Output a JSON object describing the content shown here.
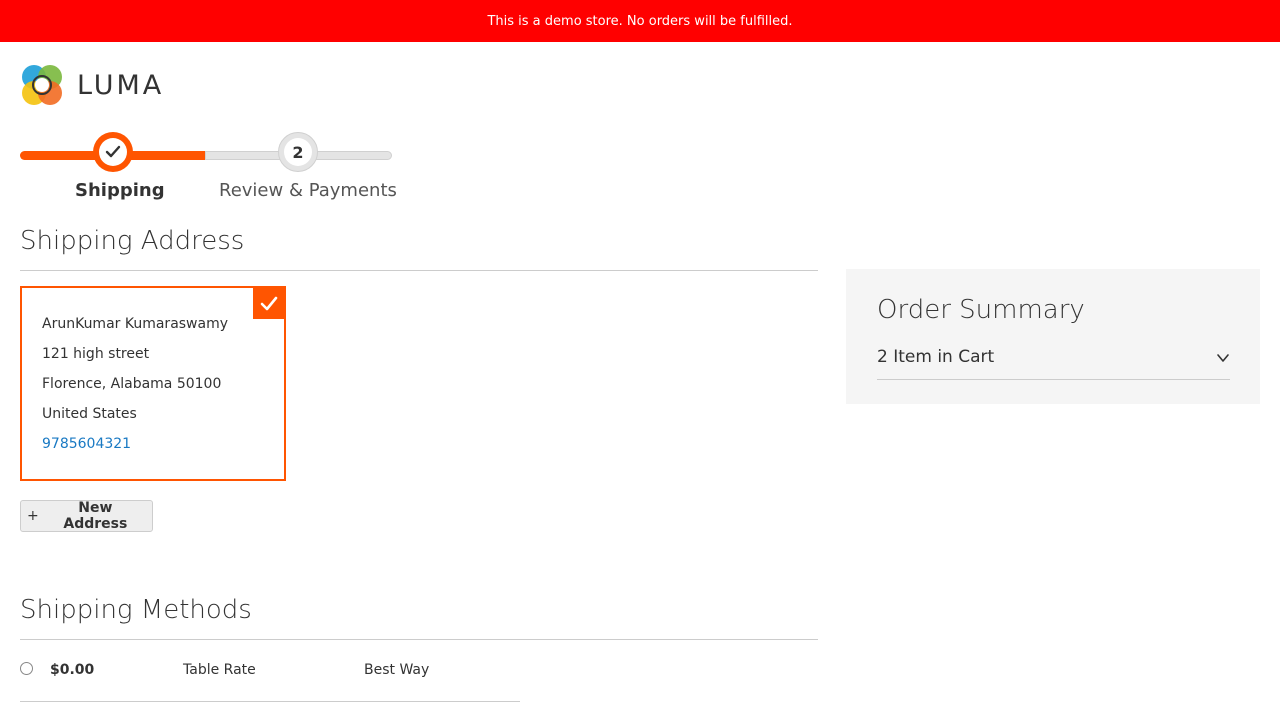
{
  "banner": {
    "text": "This is a demo store. No orders will be fulfilled."
  },
  "brand": {
    "logo_text": "LUMA",
    "accent": "#ff5501",
    "link_color": "#1979c3",
    "banner_color": "#ff0000"
  },
  "progress": {
    "steps": [
      {
        "label": "Shipping",
        "state": "complete",
        "icon": "checkmark-icon"
      },
      {
        "label": "Review & Payments",
        "state": "pending",
        "number": "2"
      }
    ]
  },
  "shipping_address": {
    "title": "Shipping Address",
    "selected_address": {
      "name": "ArunKumar Kumaraswamy",
      "street": "121 high street",
      "city_line": "Florence, Alabama 50100",
      "country": "United States",
      "phone": "9785604321"
    },
    "new_address_label": "New Address",
    "new_address_icon": "+"
  },
  "shipping_methods": {
    "title": "Shipping Methods",
    "rows": [
      {
        "price": "$0.00",
        "carrier": "Table Rate",
        "method": "Best Way",
        "selected": false
      }
    ]
  },
  "order_summary": {
    "title": "Order Summary",
    "cart_label": "2 Item in Cart",
    "toggle_icon": "chevron-down-icon"
  }
}
